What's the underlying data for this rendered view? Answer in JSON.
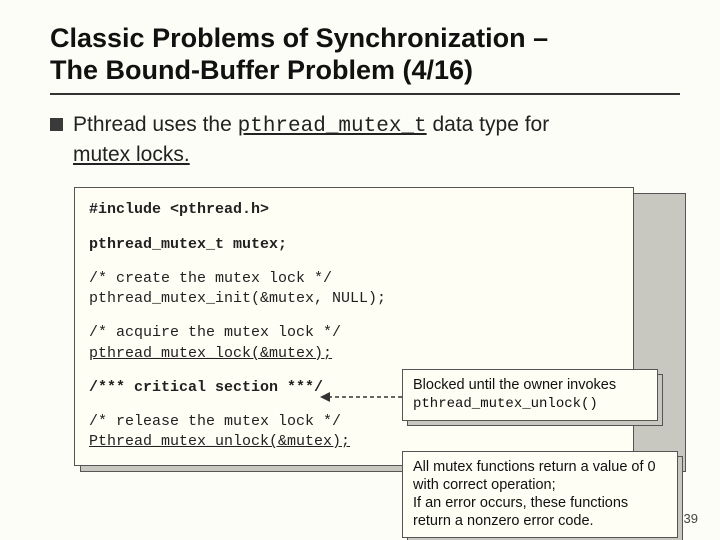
{
  "title_line1": "Classic Problems of Synchronization –",
  "title_line2": "The Bound-Buffer Problem (4/16)",
  "bullet": {
    "pre": "Pthread uses the ",
    "code": "pthread_mutex_t",
    "post1": " data type for ",
    "post2": "mutex locks."
  },
  "code": {
    "l1": "#include <pthread.h>",
    "l2": "pthread_mutex_t mutex;",
    "l3a": "/* create the mutex lock */",
    "l3b": "pthread_mutex_init(&mutex, NULL);",
    "l4a": "/* acquire the mutex lock */",
    "l4b": "pthread_mutex_lock(&mutex);",
    "l5": "/*** critical section ***/",
    "l6a": "/* release the mutex lock */",
    "l6b": "Pthread_mutex_unlock(&mutex);"
  },
  "callout1": {
    "line1": "Blocked until the owner invokes",
    "line2": "pthread_mutex_unlock()"
  },
  "callout2": {
    "l1": "All mutex functions return a value of 0",
    "l2": "with correct operation;",
    "l3": "If an error occurs, these functions",
    "l4": "return a nonzero error code."
  },
  "page_number": "39"
}
